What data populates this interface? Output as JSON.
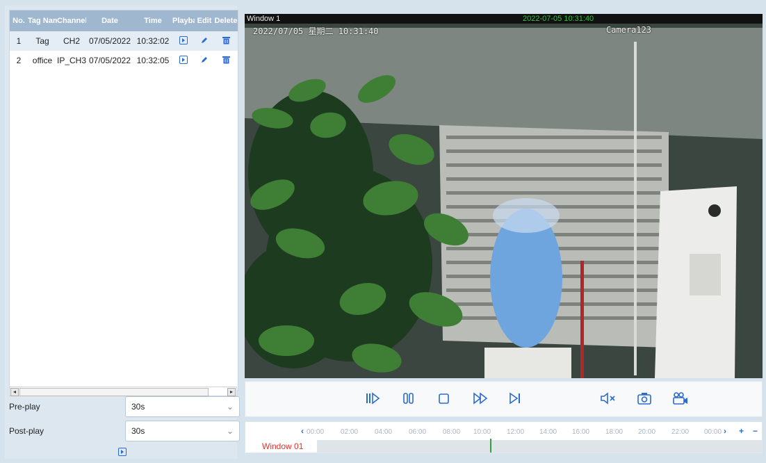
{
  "table": {
    "headers": [
      "No.",
      "Tag Name",
      "Channel",
      "Date",
      "Time",
      "Playback",
      "Edit",
      "Delete"
    ],
    "rows": [
      {
        "no": "1",
        "tag": "Tag",
        "channel": "CH2",
        "date": "07/05/2022",
        "time": "10:32:02"
      },
      {
        "no": "2",
        "tag": "office",
        "channel": "IP_CH3",
        "date": "07/05/2022",
        "time": "10:32:05"
      }
    ]
  },
  "form": {
    "preplay_label": "Pre-play",
    "preplay_value": "30s",
    "postplay_label": "Post-play",
    "postplay_value": "30s"
  },
  "video": {
    "window_title": "Window 1",
    "timestamp": "2022-07-05 10:31:40",
    "osd_datetime": "2022/07/05  星期二  10:31:40",
    "osd_camera": "Camera123"
  },
  "timeline": {
    "window_label": "Window 01",
    "ticks": [
      "00:00",
      "02:00",
      "04:00",
      "06:00",
      "08:00",
      "10:00",
      "12:00",
      "14:00",
      "16:00",
      "18:00",
      "20:00",
      "22:00",
      "00:00"
    ],
    "zoom_in": "+",
    "zoom_out": "−"
  },
  "colors": {
    "accent": "#2a6ad1",
    "header": "#9fb8cf",
    "window_label": "#e0302b",
    "cursor": "#2fa23b"
  }
}
